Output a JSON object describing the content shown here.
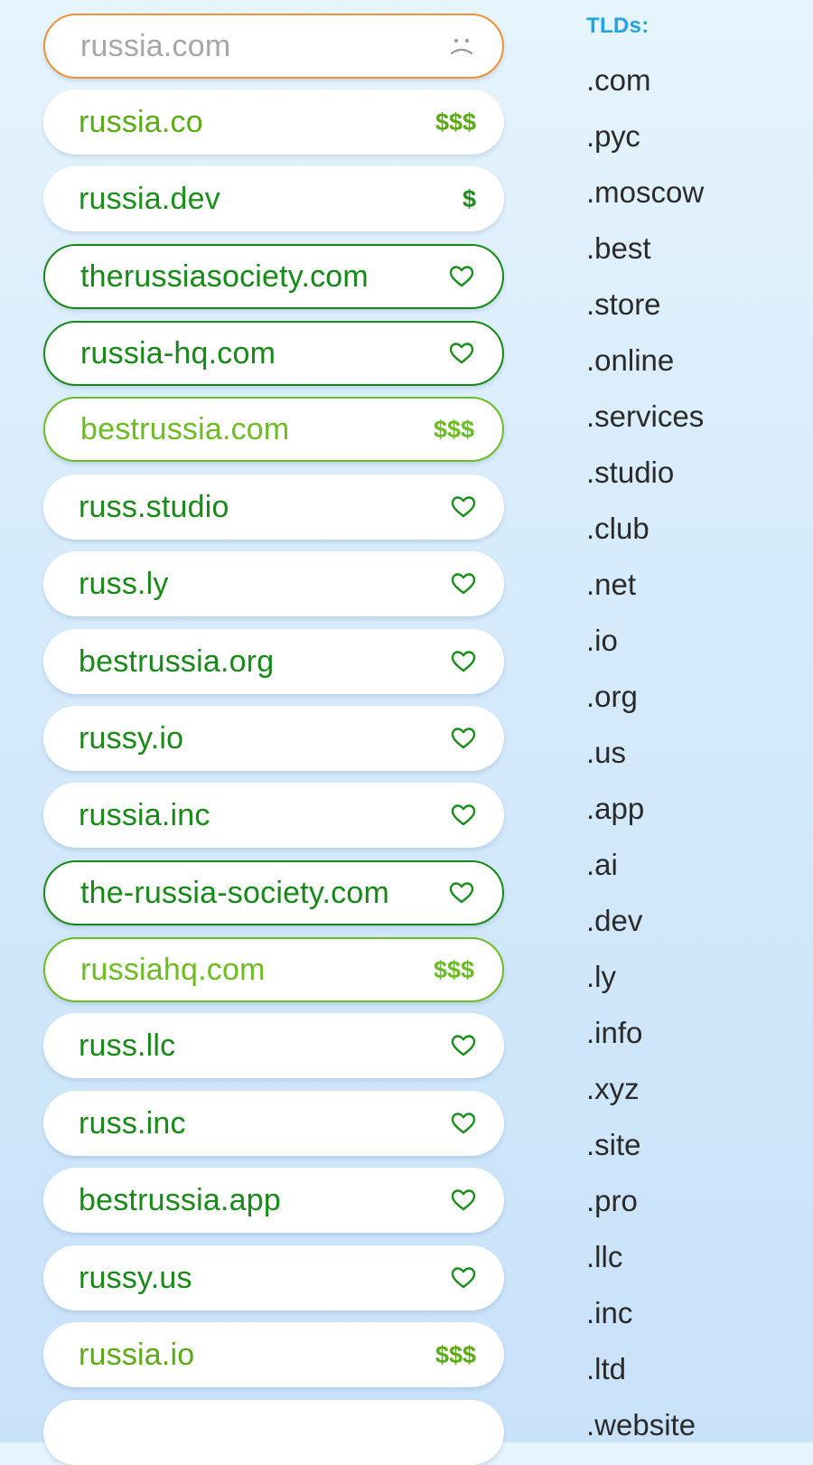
{
  "results": [
    {
      "name": "russia.com",
      "badge": "",
      "icon": "frown-icon",
      "state": "taken"
    },
    {
      "name": "russia.co",
      "badge": "$$$",
      "icon": "",
      "state": "premium"
    },
    {
      "name": "russia.dev",
      "badge": "$",
      "icon": "",
      "state": "cheap"
    },
    {
      "name": "therussiasociety.com",
      "badge": "",
      "icon": "heart-icon",
      "state": "available-outline"
    },
    {
      "name": "russia-hq.com",
      "badge": "",
      "icon": "heart-icon",
      "state": "available-outline"
    },
    {
      "name": "bestrussia.com",
      "badge": "$$$",
      "icon": "",
      "state": "premium-outline"
    },
    {
      "name": "russ.studio",
      "badge": "",
      "icon": "heart-icon",
      "state": "available"
    },
    {
      "name": "russ.ly",
      "badge": "",
      "icon": "heart-icon",
      "state": "available"
    },
    {
      "name": "bestrussia.org",
      "badge": "",
      "icon": "heart-icon",
      "state": "available"
    },
    {
      "name": "russy.io",
      "badge": "",
      "icon": "heart-icon",
      "state": "available"
    },
    {
      "name": "russia.inc",
      "badge": "",
      "icon": "heart-icon",
      "state": "available"
    },
    {
      "name": "the-russia-society.com",
      "badge": "",
      "icon": "heart-icon",
      "state": "available-outline"
    },
    {
      "name": "russiahq.com",
      "badge": "$$$",
      "icon": "",
      "state": "premium-outline"
    },
    {
      "name": "russ.llc",
      "badge": "",
      "icon": "heart-icon",
      "state": "available"
    },
    {
      "name": "russ.inc",
      "badge": "",
      "icon": "heart-icon",
      "state": "available"
    },
    {
      "name": "bestrussia.app",
      "badge": "",
      "icon": "heart-icon",
      "state": "available"
    },
    {
      "name": "russy.us",
      "badge": "",
      "icon": "heart-icon",
      "state": "available"
    },
    {
      "name": "russia.io",
      "badge": "$$$",
      "icon": "",
      "state": "premium"
    },
    {
      "name": "",
      "badge": "",
      "icon": "",
      "state": "available"
    }
  ],
  "tlds": {
    "heading": "TLDs:",
    "items": [
      ".com",
      ".рус",
      ".moscow",
      ".best",
      ".store",
      ".online",
      ".services",
      ".studio",
      ".club",
      ".net",
      ".io",
      ".org",
      ".us",
      ".app",
      ".ai",
      ".dev",
      ".ly",
      ".info",
      ".xyz",
      ".site",
      ".pro",
      ".llc",
      ".inc",
      ".ltd",
      ".website"
    ]
  },
  "colors": {
    "background": "#d6ebfb",
    "available": "#1a8f1a",
    "premium": "#5aac12",
    "taken_border": "#f0913a",
    "tld_heading": "#22a4e2"
  }
}
